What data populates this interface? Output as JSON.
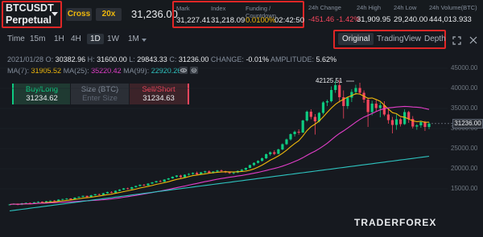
{
  "header": {
    "symbol_line1": "BTCUSDT",
    "symbol_line2": "Perpetual",
    "margin_mode": "Cross",
    "leverage": "20x",
    "last_price": "31,236.00",
    "mark_label": "Mark",
    "mark_value": "31,227.41",
    "index_label": "Index",
    "index_value": "31,218.09",
    "funding_label": "Funding / Countdown",
    "funding_rate": "0.0100%",
    "countdown": "02:42:50",
    "change_label": "24h Change",
    "change_value": "-451.46 -1.42%",
    "high_label": "24h High",
    "high_value": "31,909.95",
    "low_label": "24h Low",
    "low_value": "29,240.00",
    "volume_label": "24h Volume(BTC)",
    "volume_value": "444,013.933"
  },
  "toolbar": {
    "time_label": "Time",
    "intervals": [
      "15m",
      "1H",
      "4H",
      "1D",
      "1W",
      "1M"
    ],
    "active_interval": "1D",
    "views": [
      "Original",
      "TradingView",
      "Depth"
    ],
    "active_view": "Original"
  },
  "ohlc": {
    "date": "2021/01/28",
    "o_label": "O:",
    "o_value": "30382.96",
    "h_label": "H:",
    "h_value": "31600.00",
    "l_label": "L:",
    "l_value": "29843.33",
    "c_label": "C:",
    "c_value": "31236.00",
    "change_label": "CHANGE:",
    "change_value": "-0.01%",
    "amplitude_label": "AMPLITUDE:",
    "amplitude_value": "5.62%"
  },
  "ma": {
    "ma7_label": "MA(7):",
    "ma7_value": "31905.52",
    "ma25_label": "MA(25):",
    "ma25_value": "35220.42",
    "ma99_label": "MA(99):",
    "ma99_value": "22920.26"
  },
  "order": {
    "buy_label": "Buy/Long",
    "buy_price": "31234.62",
    "size_label": "Size (BTC)",
    "size_placeholder": "Enter Size",
    "sell_label": "Sell/Short",
    "sell_price": "31234.63"
  },
  "chart_data": {
    "type": "line",
    "candles": [
      [
        11000,
        11200,
        10850,
        11100
      ],
      [
        11100,
        11400,
        11000,
        11300
      ],
      [
        11300,
        11350,
        10900,
        11050
      ],
      [
        11050,
        11500,
        10950,
        11400
      ],
      [
        11400,
        11600,
        11200,
        11500
      ],
      [
        11500,
        11550,
        11100,
        11250
      ],
      [
        11250,
        11700,
        11200,
        11650
      ],
      [
        11650,
        11900,
        11500,
        11800
      ],
      [
        11800,
        11850,
        11400,
        11550
      ],
      [
        11550,
        12000,
        11500,
        11900
      ],
      [
        11900,
        12100,
        11700,
        12050
      ],
      [
        12050,
        12200,
        11800,
        11950
      ],
      [
        11950,
        12400,
        11900,
        12300
      ],
      [
        12300,
        12500,
        12100,
        12450
      ],
      [
        12450,
        12700,
        12300,
        12600
      ],
      [
        12600,
        12650,
        12200,
        12350
      ],
      [
        12350,
        12900,
        12300,
        12800
      ],
      [
        12800,
        13100,
        12700,
        13000
      ],
      [
        13000,
        13300,
        12900,
        13250
      ],
      [
        13250,
        13300,
        12800,
        12950
      ],
      [
        12950,
        13500,
        12900,
        13400
      ],
      [
        13400,
        13700,
        13300,
        13650
      ],
      [
        13650,
        13800,
        13400,
        13500
      ],
      [
        13500,
        14000,
        13450,
        13900
      ],
      [
        13900,
        14300,
        13800,
        14200
      ],
      [
        14200,
        14400,
        13900,
        14050
      ],
      [
        14050,
        14600,
        14000,
        14500
      ],
      [
        14500,
        14900,
        14400,
        14800
      ],
      [
        14800,
        15200,
        14700,
        15100
      ],
      [
        15100,
        15300,
        14800,
        14950
      ],
      [
        14950,
        15500,
        14900,
        15400
      ],
      [
        15400,
        15800,
        15300,
        15700
      ],
      [
        15700,
        16100,
        15600,
        16000
      ],
      [
        16000,
        16200,
        15700,
        15850
      ],
      [
        15850,
        16400,
        15800,
        16300
      ],
      [
        16300,
        16700,
        16200,
        16600
      ],
      [
        16600,
        17000,
        16500,
        16900
      ],
      [
        16900,
        17200,
        16600,
        16750
      ],
      [
        16750,
        17400,
        16700,
        17300
      ],
      [
        17300,
        17700,
        17200,
        17600
      ],
      [
        17600,
        18100,
        17500,
        18000
      ],
      [
        18000,
        18400,
        17800,
        18300
      ],
      [
        18300,
        18500,
        17700,
        17900
      ],
      [
        17900,
        18600,
        17800,
        18500
      ],
      [
        18500,
        18900,
        18300,
        18700
      ],
      [
        18700,
        19100,
        18500,
        18950
      ],
      [
        18950,
        19300,
        18400,
        18600
      ],
      [
        18600,
        19200,
        18500,
        19100
      ],
      [
        19100,
        19500,
        18900,
        19350
      ],
      [
        19350,
        19600,
        18800,
        18950
      ],
      [
        18950,
        19400,
        18800,
        19300
      ],
      [
        19300,
        19700,
        19100,
        19550
      ],
      [
        19550,
        19800,
        19200,
        19400
      ],
      [
        19400,
        19500,
        18900,
        19100
      ],
      [
        19100,
        19300,
        18700,
        18900
      ],
      [
        18900,
        19200,
        18600,
        19050
      ],
      [
        19050,
        19600,
        18900,
        19450
      ],
      [
        19450,
        19900,
        19300,
        19750
      ],
      [
        19750,
        20300,
        19600,
        20200
      ],
      [
        20200,
        21000,
        20100,
        20900
      ],
      [
        20900,
        21600,
        20700,
        21450
      ],
      [
        21450,
        22100,
        21300,
        21950
      ],
      [
        21950,
        22800,
        21800,
        22600
      ],
      [
        22600,
        23800,
        22400,
        23600
      ],
      [
        23600,
        24300,
        23200,
        24100
      ],
      [
        24100,
        24600,
        23400,
        23700
      ],
      [
        23700,
        25000,
        23600,
        24800
      ],
      [
        24800,
        26300,
        24600,
        26100
      ],
      [
        26100,
        27500,
        25900,
        27300
      ],
      [
        27300,
        28800,
        27000,
        28600
      ],
      [
        28600,
        29500,
        28000,
        29200
      ],
      [
        29200,
        29800,
        28500,
        29000
      ],
      [
        29000,
        32200,
        28900,
        32000
      ],
      [
        32000,
        34500,
        31700,
        34200
      ],
      [
        34200,
        34800,
        32300,
        32900
      ],
      [
        32900,
        33600,
        28500,
        31800
      ],
      [
        31800,
        34100,
        31500,
        33900
      ],
      [
        33900,
        36800,
        33500,
        36500
      ],
      [
        36500,
        37200,
        35600,
        36800
      ],
      [
        36800,
        40500,
        36500,
        39600
      ],
      [
        39600,
        41900,
        38900,
        40800
      ],
      [
        40800,
        42125.51,
        36500,
        37800
      ],
      [
        37800,
        39500,
        32500,
        35600
      ],
      [
        35600,
        37900,
        34900,
        37700
      ],
      [
        37700,
        39800,
        36600,
        39100
      ],
      [
        39100,
        40900,
        38400,
        40100
      ],
      [
        40100,
        41400,
        38600,
        38900
      ],
      [
        38900,
        39500,
        36400,
        37200
      ],
      [
        37200,
        37700,
        30400,
        34100
      ],
      [
        34100,
        36900,
        33300,
        36200
      ],
      [
        36200,
        37300,
        34300,
        35100
      ],
      [
        35100,
        36500,
        32800,
        35800
      ],
      [
        35800,
        36800,
        33100,
        33500
      ],
      [
        33500,
        34900,
        31200,
        32100
      ],
      [
        32100,
        32900,
        28800,
        30900
      ],
      [
        30900,
        33500,
        29700,
        32300
      ],
      [
        32300,
        32700,
        30500,
        31100
      ],
      [
        31100,
        34800,
        30900,
        34100
      ],
      [
        34100,
        34400,
        31400,
        32400
      ],
      [
        32400,
        33100,
        30000,
        30500
      ],
      [
        30500,
        31100,
        29700,
        30800
      ],
      [
        30800,
        32000,
        30200,
        31600
      ],
      [
        31600,
        31900,
        29400,
        30400
      ],
      [
        30400,
        31600,
        29840,
        31236
      ]
    ],
    "ylim": [
      10000,
      45000
    ],
    "yticks": [
      "45000.00",
      "40000.00",
      "35000.00",
      "30000.00",
      "25000.00",
      "20000.00",
      "15000.00"
    ],
    "high_marker": "42125.51",
    "current_price_label": "31236.00"
  },
  "watermark": "TRADERFOREX",
  "icons": {
    "caret": "chevron-down-icon",
    "fullscreen": "fullscreen-icon",
    "close": "close-icon",
    "eye": "eye-icon",
    "settings": "gear-icon"
  }
}
